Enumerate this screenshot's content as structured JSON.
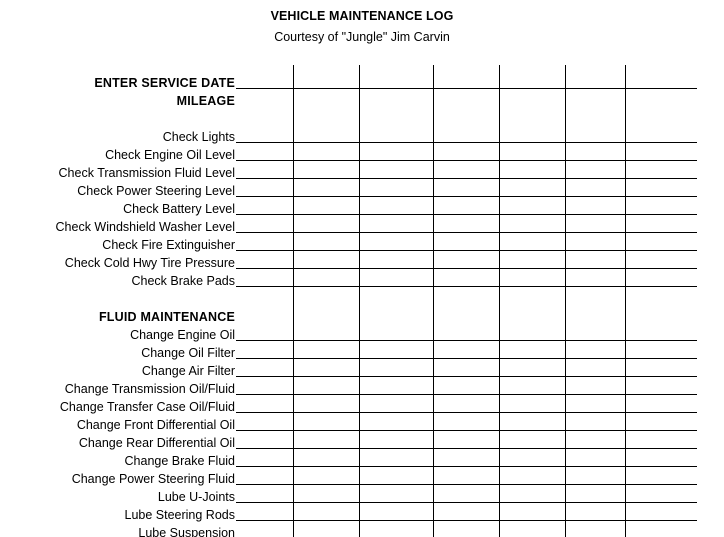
{
  "document": {
    "title": "VEHICLE MAINTENANCE LOG",
    "subtitle": "Courtesy of \"Jungle\" Jim Carvin"
  },
  "grid": {
    "column_line_count": 6,
    "line_color": "#000000",
    "column_x_positions": [
      293,
      359,
      433,
      499,
      565,
      625
    ],
    "rule_right_edge": 697
  },
  "rows": [
    {
      "label": "ENTER  SERVICE  DATE",
      "style": "head",
      "rule": true
    },
    {
      "label": "MILEAGE",
      "style": "head",
      "rule": false
    },
    {
      "label": "",
      "style": "spacer",
      "rule": false
    },
    {
      "label": "Check  Lights",
      "style": "item",
      "rule": true
    },
    {
      "label": "Check Engine Oil Level",
      "style": "item",
      "rule": true
    },
    {
      "label": "Check Transmission Fluid Level",
      "style": "item",
      "rule": true
    },
    {
      "label": "Check Power Steering Level",
      "style": "item",
      "rule": true
    },
    {
      "label": "Check  Battery  Level",
      "style": "item",
      "rule": true
    },
    {
      "label": "Check  Windshield  Washer  Level",
      "style": "item",
      "rule": true
    },
    {
      "label": "Check Fire Extinguisher",
      "style": "item",
      "rule": true
    },
    {
      "label": "Check Cold Hwy Tire Pressure",
      "style": "item",
      "rule": true
    },
    {
      "label": "Check  Brake Pads",
      "style": "item",
      "rule": true
    },
    {
      "label": "",
      "style": "spacer",
      "rule": false
    },
    {
      "label": "FLUID  MAINTENANCE",
      "style": "head",
      "rule": false
    },
    {
      "label": "Change Engine Oil",
      "style": "item",
      "rule": true
    },
    {
      "label": "Change  Oil  Filter",
      "style": "item",
      "rule": true
    },
    {
      "label": "Change  Air  Filter",
      "style": "item",
      "rule": true
    },
    {
      "label": "Change Transmission Oil/Fluid",
      "style": "item",
      "rule": true
    },
    {
      "label": "Change Transfer Case Oil/Fluid",
      "style": "item",
      "rule": true
    },
    {
      "label": "Change  Front  Differential  Oil",
      "style": "item",
      "rule": true
    },
    {
      "label": "Change  Rear  Differential  Oil",
      "style": "item",
      "rule": true
    },
    {
      "label": "Change Brake Fluid",
      "style": "item",
      "rule": true
    },
    {
      "label": "Change Power Steering Fluid",
      "style": "item",
      "rule": true
    },
    {
      "label": "Lube U-Joints",
      "style": "item",
      "rule": true
    },
    {
      "label": "Lube Steering Rods",
      "style": "item",
      "rule": true
    },
    {
      "label": "Lube Suspension",
      "style": "item",
      "rule": true
    }
  ]
}
